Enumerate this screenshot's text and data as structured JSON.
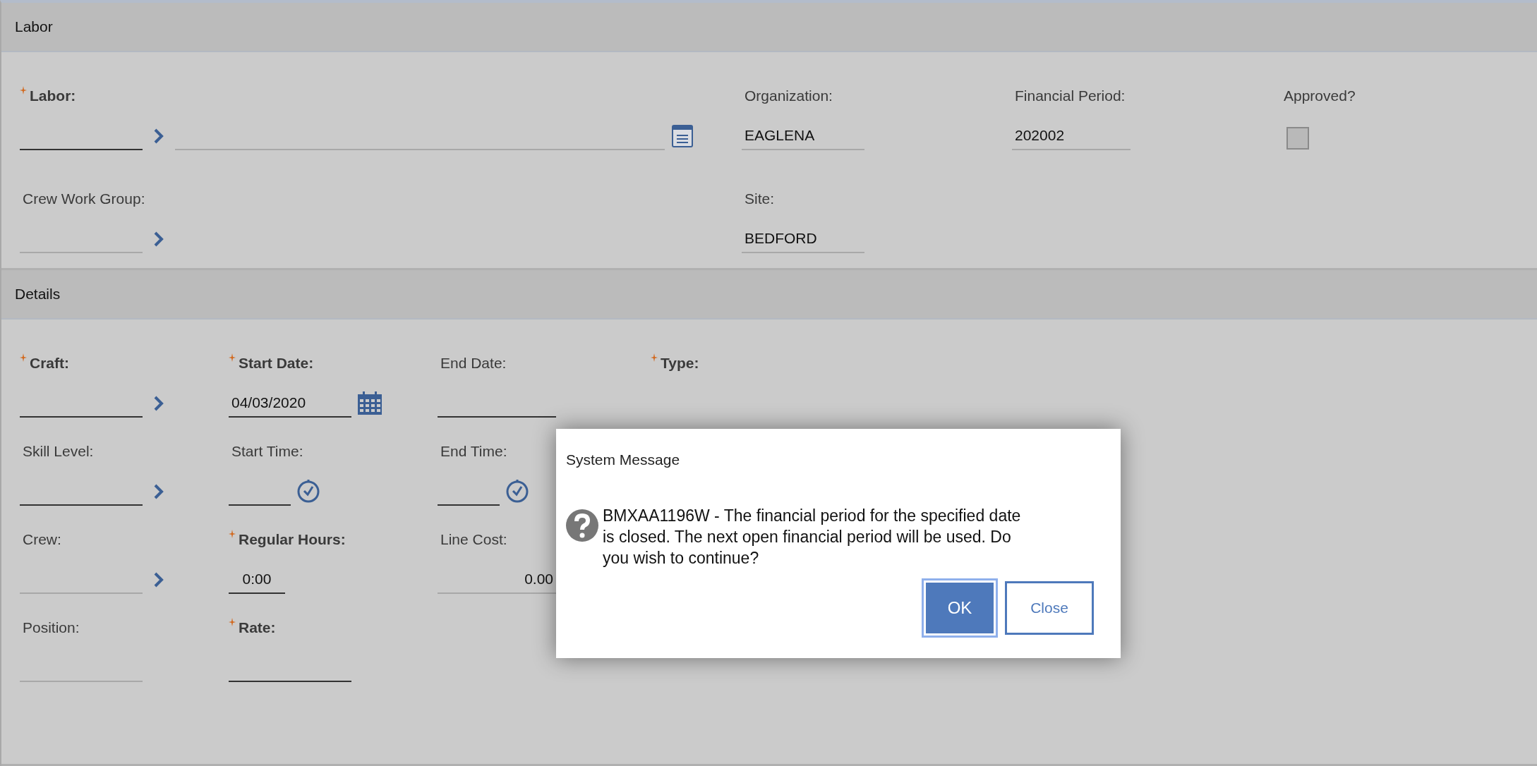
{
  "sections": [
    {
      "title": "Labor",
      "kind": "labor",
      "rows": [
        [
          {
            "label": "Labor:",
            "required": true,
            "kind": "lookup_desc",
            "readonly": false
          },
          {
            "label": "Organization:",
            "required": false,
            "kind": "text",
            "value": "EAGLENA",
            "readonly": true
          },
          {
            "label": "Financial Period:",
            "required": false,
            "kind": "text",
            "value": "202002",
            "readonly": true
          },
          {
            "label": "Approved?",
            "required": false,
            "kind": "checkbox",
            "checked": false
          }
        ],
        [
          {
            "label": "Crew Work Group:",
            "required": false,
            "kind": "lookup",
            "readonly": true
          },
          {
            "label": "Site:",
            "required": false,
            "kind": "text",
            "value": "BEDFORD",
            "readonly": true
          }
        ]
      ]
    },
    {
      "title": "Details",
      "kind": "details",
      "rows": [
        [
          {
            "label": "Craft:",
            "required": true,
            "kind": "lookup",
            "readonly": false
          },
          {
            "label": "Start Date:",
            "required": true,
            "kind": "date",
            "value": "04/03/2020",
            "readonly": false
          },
          {
            "label": "End Date:",
            "required": false,
            "kind": "text",
            "readonly": false
          },
          {
            "label": "Type:",
            "required": true,
            "kind": "label"
          }
        ],
        [
          {
            "label": "Skill Level:",
            "required": false,
            "kind": "lookup",
            "readonly": false
          },
          {
            "label": "Start Time:",
            "required": false,
            "kind": "time",
            "readonly": false
          },
          {
            "label": "End Time:",
            "required": false,
            "kind": "time",
            "readonly": false
          }
        ],
        [
          {
            "label": "Crew:",
            "required": false,
            "kind": "lookup",
            "readonly": true
          },
          {
            "label": "Regular Hours:",
            "required": true,
            "kind": "hours",
            "value": "0:00",
            "readonly": false
          },
          {
            "label": "Line Cost:",
            "required": false,
            "kind": "number",
            "value": "0.00",
            "readonly": true
          }
        ],
        [
          {
            "label": "Position:",
            "required": false,
            "kind": "text",
            "readonly": true
          },
          {
            "label": "Rate:",
            "required": true,
            "kind": "text",
            "readonly": false
          }
        ]
      ]
    }
  ],
  "dialog": {
    "title": "System Message",
    "message": "BMXAA1196W - The financial period for the specified date is closed. The next open financial period will be used. Do you wish to continue?",
    "buttons": [
      {
        "label": "OK",
        "kind": "primary",
        "focused": true
      },
      {
        "label": "Close",
        "kind": "secondary",
        "focused": false
      }
    ]
  }
}
